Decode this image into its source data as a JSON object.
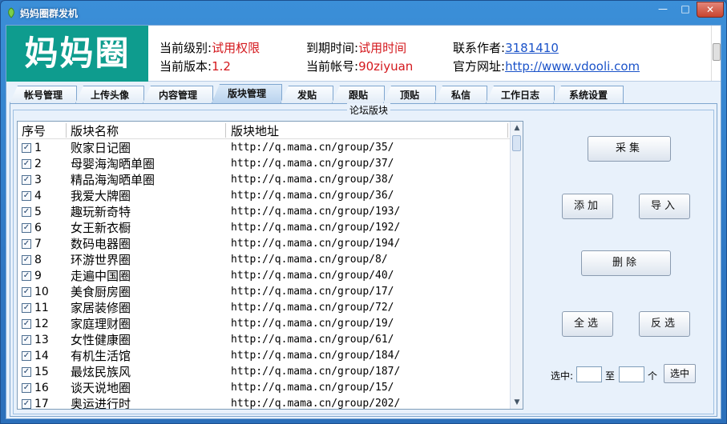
{
  "window": {
    "title": "妈妈圈群发机",
    "controls": [
      "minimize-icon",
      "maximize-icon",
      "close-icon"
    ]
  },
  "header": {
    "logo": "妈妈圈",
    "level_label": "当前级别:",
    "level_value": "试用权限",
    "version_label": "当前版本:",
    "version_value": "1.2",
    "expire_label": "到期时间:",
    "expire_value": "试用时间",
    "account_label": "当前帐号:",
    "account_value": "90ziyuan",
    "author_label": "联系作者:",
    "author_value": "3181410",
    "site_label": "官方网址:",
    "site_value": "http://www.vdooli.com"
  },
  "tabs": [
    {
      "label": "帐号管理",
      "active": false
    },
    {
      "label": "上传头像",
      "active": false
    },
    {
      "label": "内容管理",
      "active": false
    },
    {
      "label": "版块管理",
      "active": true
    },
    {
      "label": "发贴",
      "active": false
    },
    {
      "label": "跟贴",
      "active": false
    },
    {
      "label": "顶贴",
      "active": false
    },
    {
      "label": "私信",
      "active": false
    },
    {
      "label": "工作日志",
      "active": false
    },
    {
      "label": "系统设置",
      "active": false
    }
  ],
  "panel": {
    "group_title": "论坛版块",
    "columns": [
      "序号",
      "版块名称",
      "版块地址"
    ],
    "rows": [
      {
        "no": "1",
        "name": "败家日记圈",
        "url": "http://q.mama.cn/group/35/",
        "checked": true
      },
      {
        "no": "2",
        "name": "母婴海淘晒单圈",
        "url": "http://q.mama.cn/group/37/",
        "checked": true
      },
      {
        "no": "3",
        "name": "精品海淘晒单圈",
        "url": "http://q.mama.cn/group/38/",
        "checked": true
      },
      {
        "no": "4",
        "name": "我爱大牌圈",
        "url": "http://q.mama.cn/group/36/",
        "checked": true
      },
      {
        "no": "5",
        "name": "趣玩新奇特",
        "url": "http://q.mama.cn/group/193/",
        "checked": true
      },
      {
        "no": "6",
        "name": "女王新衣橱",
        "url": "http://q.mama.cn/group/192/",
        "checked": true
      },
      {
        "no": "7",
        "name": "数码电器圈",
        "url": "http://q.mama.cn/group/194/",
        "checked": true
      },
      {
        "no": "8",
        "name": "环游世界圈",
        "url": "http://q.mama.cn/group/8/",
        "checked": true
      },
      {
        "no": "9",
        "name": "走遍中国圈",
        "url": "http://q.mama.cn/group/40/",
        "checked": true
      },
      {
        "no": "10",
        "name": "美食厨房圈",
        "url": "http://q.mama.cn/group/17/",
        "checked": true
      },
      {
        "no": "11",
        "name": "家居装修圈",
        "url": "http://q.mama.cn/group/72/",
        "checked": true
      },
      {
        "no": "12",
        "name": "家庭理财圈",
        "url": "http://q.mama.cn/group/19/",
        "checked": true
      },
      {
        "no": "13",
        "name": "女性健康圈",
        "url": "http://q.mama.cn/group/61/",
        "checked": true
      },
      {
        "no": "14",
        "name": "有机生活馆",
        "url": "http://q.mama.cn/group/184/",
        "checked": true
      },
      {
        "no": "15",
        "name": "最炫民族风",
        "url": "http://q.mama.cn/group/187/",
        "checked": true
      },
      {
        "no": "16",
        "name": "谈天说地圈",
        "url": "http://q.mama.cn/group/15/",
        "checked": true
      },
      {
        "no": "17",
        "name": "奥运进行时",
        "url": "http://q.mama.cn/group/202/",
        "checked": true
      }
    ]
  },
  "buttons": {
    "collect": "采集",
    "add": "添加",
    "import": "导入",
    "delete": "删除",
    "select_all": "全选",
    "invert": "反选",
    "range_label": "选中:",
    "range_to": "至",
    "range_unit": "个",
    "range_from_value": "",
    "range_to_value": "",
    "range_select": "选中"
  },
  "colors": {
    "logo_bg": "#0e9c8e",
    "highlight_red": "#d4181d",
    "link_blue": "#1b53c9",
    "titlebar_blue": "#2f78c4"
  }
}
